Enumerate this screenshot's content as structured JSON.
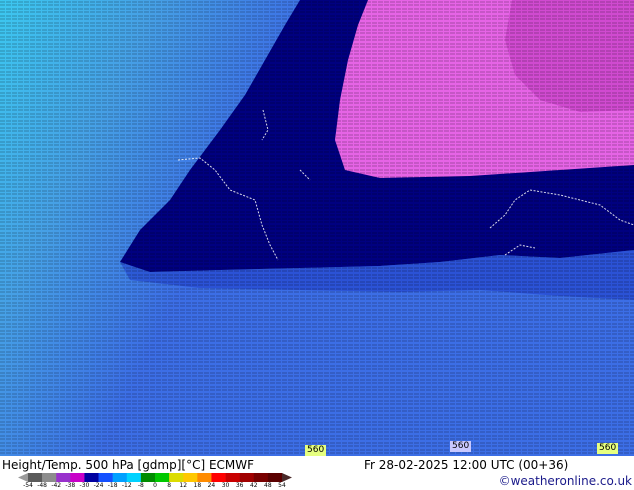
{
  "map": {
    "title": "Height/Temp. 500 hPa [gdmp][°C] ECMWF",
    "datetime": "Fr 28-02-2025 12:00 UTC (00+36)",
    "credit": "©weatheronline.co.uk",
    "contour_labels": [
      {
        "text": "560",
        "highlight": true
      },
      {
        "text": "560",
        "highlight": false
      },
      {
        "text": "560",
        "highlight": true
      }
    ],
    "legend": {
      "arrow_left_color": "#9a9a9a",
      "arrow_right_color": "#4a2a2a",
      "bands": [
        {
          "color": "#5a5a5a"
        },
        {
          "color": "#8c8c8c"
        },
        {
          "color": "#9932cc"
        },
        {
          "color": "#c800c8"
        },
        {
          "color": "#0000a0"
        },
        {
          "color": "#1450ff"
        },
        {
          "color": "#00a0ff"
        },
        {
          "color": "#00d2ff"
        },
        {
          "color": "#008c00"
        },
        {
          "color": "#00c800"
        },
        {
          "color": "#dcdc00"
        },
        {
          "color": "#ffc800"
        },
        {
          "color": "#ff8c00"
        },
        {
          "color": "#ff0000"
        },
        {
          "color": "#c80000"
        },
        {
          "color": "#a00000"
        },
        {
          "color": "#780000"
        },
        {
          "color": "#5a0000"
        }
      ],
      "ticks": [
        "-54",
        "-48",
        "-42",
        "-38",
        "-30",
        "-24",
        "-18",
        "-12",
        "-8",
        "0",
        "8",
        "12",
        "18",
        "24",
        "30",
        "36",
        "42",
        "48",
        "54"
      ]
    },
    "colors": {
      "deep_blue": "#000080",
      "mid_blue": "#3c6ee6",
      "light_blue": "#46a0e6",
      "cyan": "#3cc8f0",
      "pink": "#e664e6",
      "light_pink": "#f08cf0"
    }
  }
}
